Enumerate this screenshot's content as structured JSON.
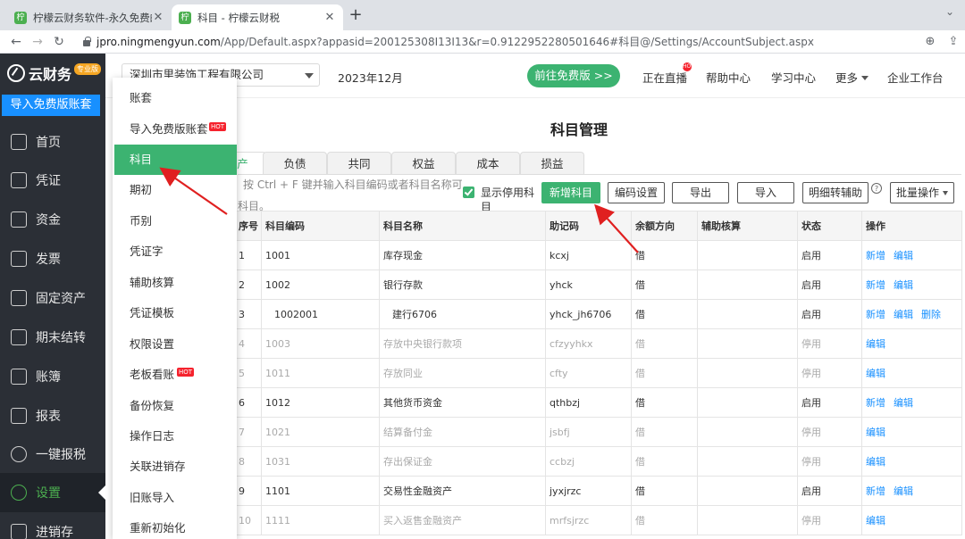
{
  "browser": {
    "tabs": [
      {
        "title": "柠檬云财务软件-永久免费的专业",
        "active": false
      },
      {
        "title": "科目 - 柠檬云财税",
        "active": true
      }
    ],
    "url_host": "jpro.ningmengyun.com",
    "url_path": "/App/Default.aspx?appasid=200125308I13I13&r=0.9122952280501646#科目@/Settings/AccountSubject.aspx"
  },
  "sidebar": {
    "logo": "云财务",
    "logo_badge": "专业版",
    "import_button": "导入免费版账套",
    "items": [
      {
        "label": "首页",
        "icon": "home-icon"
      },
      {
        "label": "凭证",
        "icon": "voucher-icon"
      },
      {
        "label": "资金",
        "icon": "fund-icon"
      },
      {
        "label": "发票",
        "icon": "invoice-icon"
      },
      {
        "label": "固定资产",
        "icon": "asset-icon"
      },
      {
        "label": "期末结转",
        "icon": "calendar-icon"
      },
      {
        "label": "账簿",
        "icon": "ledger-icon"
      },
      {
        "label": "报表",
        "icon": "chart-icon"
      },
      {
        "label": "一键报税",
        "icon": "tax-icon"
      },
      {
        "label": "设置",
        "icon": "gear-icon",
        "active": true
      },
      {
        "label": "进销存",
        "icon": "inventory-icon"
      }
    ]
  },
  "header": {
    "company": "深圳市里装饰工程有限公司",
    "period": "2023年12月",
    "free_button": "前往免费版 >>",
    "links": [
      "正在直播",
      "帮助中心",
      "学习中心",
      "更多",
      "企业工作台"
    ],
    "live_badge": "HOT"
  },
  "settings_menu": {
    "items": [
      {
        "label": "账套"
      },
      {
        "label": "导入免费版账套",
        "hot": "HOT"
      },
      {
        "label": "科目",
        "active": true
      },
      {
        "label": "期初"
      },
      {
        "label": "币别"
      },
      {
        "label": "凭证字"
      },
      {
        "label": "辅助核算"
      },
      {
        "label": "凭证模板"
      },
      {
        "label": "权限设置"
      },
      {
        "label": "老板看账",
        "hot": "HOT"
      },
      {
        "label": "备份恢复"
      },
      {
        "label": "操作日志"
      },
      {
        "label": "关联进销存"
      },
      {
        "label": "旧账导入"
      },
      {
        "label": "重新初始化"
      }
    ]
  },
  "main": {
    "title": "科目管理",
    "tabs": [
      "产",
      "负债",
      "共同",
      "权益",
      "成本",
      "损益"
    ],
    "hint": "按 Ctrl + F 键并输入科目编码或者科目名称可",
    "hint2": "科目。",
    "show_disabled": "显示停用科目",
    "buttons": {
      "add": "新增科目",
      "code_settings": "编码设置",
      "export": "导出",
      "import": "导入",
      "detail_to_aux": "明细转辅助",
      "bulk": "批量操作"
    },
    "table": {
      "headers": [
        "序号",
        "科目编码",
        "科目名称",
        "助记码",
        "余额方向",
        "辅助核算",
        "状态",
        "操作"
      ],
      "rows": [
        {
          "no": "1",
          "code": "1001",
          "name": "库存现金",
          "mnemonic": "kcxj",
          "direction": "借",
          "aux": "",
          "status": "启用",
          "ops": [
            "新增",
            "编辑"
          ],
          "disabled": false
        },
        {
          "no": "2",
          "code": "1002",
          "name": "银行存款",
          "mnemonic": "yhck",
          "direction": "借",
          "aux": "",
          "status": "启用",
          "ops": [
            "新增",
            "编辑"
          ],
          "disabled": false
        },
        {
          "no": "3",
          "code": "1002001",
          "name": "建行6706",
          "mnemonic": "yhck_jh6706",
          "direction": "借",
          "aux": "",
          "status": "启用",
          "ops": [
            "新增",
            "编辑",
            "删除"
          ],
          "disabled": false,
          "indent": true
        },
        {
          "no": "4",
          "code": "1003",
          "name": "存放中央银行款项",
          "mnemonic": "cfzyyhkx",
          "direction": "借",
          "aux": "",
          "status": "停用",
          "ops": [
            "编辑"
          ],
          "disabled": true
        },
        {
          "no": "5",
          "code": "1011",
          "name": "存放同业",
          "mnemonic": "cfty",
          "direction": "借",
          "aux": "",
          "status": "停用",
          "ops": [
            "编辑"
          ],
          "disabled": true
        },
        {
          "no": "6",
          "code": "1012",
          "name": "其他货币资金",
          "mnemonic": "qthbzj",
          "direction": "借",
          "aux": "",
          "status": "启用",
          "ops": [
            "新增",
            "编辑"
          ],
          "disabled": false
        },
        {
          "no": "7",
          "code": "1021",
          "name": "结算备付金",
          "mnemonic": "jsbfj",
          "direction": "借",
          "aux": "",
          "status": "停用",
          "ops": [
            "编辑"
          ],
          "disabled": true
        },
        {
          "no": "8",
          "code": "1031",
          "name": "存出保证金",
          "mnemonic": "ccbzj",
          "direction": "借",
          "aux": "",
          "status": "停用",
          "ops": [
            "编辑"
          ],
          "disabled": true
        },
        {
          "no": "9",
          "code": "1101",
          "name": "交易性金融资产",
          "mnemonic": "jyxjrzc",
          "direction": "借",
          "aux": "",
          "status": "启用",
          "ops": [
            "新增",
            "编辑"
          ],
          "disabled": false
        },
        {
          "no": "10",
          "code": "1111",
          "name": "买入返售金融资产",
          "mnemonic": "mrfsjrzc",
          "direction": "借",
          "aux": "",
          "status": "停用",
          "ops": [
            "编辑"
          ],
          "disabled": true
        }
      ]
    }
  },
  "colors": {
    "accent": "#3cb371",
    "sidebar_bg": "#2b2f36",
    "link": "#1890ff",
    "arrow": "#e02020"
  }
}
